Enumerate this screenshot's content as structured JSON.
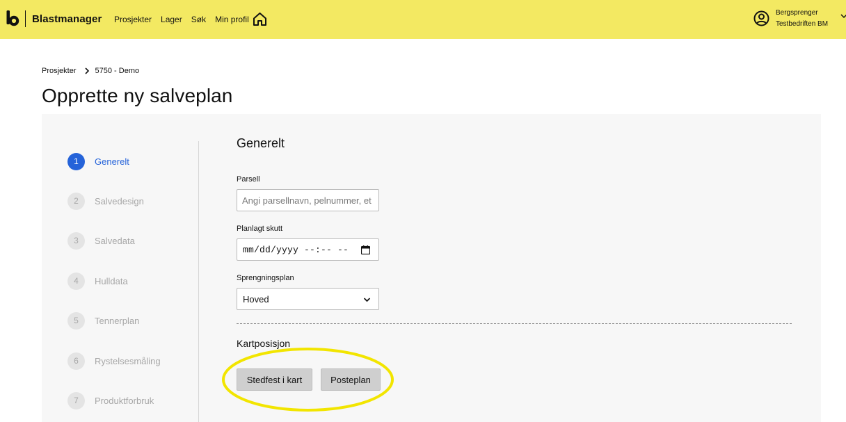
{
  "header": {
    "brand": "Blastmanager",
    "nav": [
      "Prosjekter",
      "Lager",
      "Søk",
      "Min profil"
    ],
    "icons": {
      "logo": "blastmanager-logo-icon",
      "home": "home-icon",
      "user": "user-circle-icon",
      "chevron": "chevron-down-icon"
    },
    "user": {
      "name": "Bergsprenger",
      "company": "Testbedriften BM"
    },
    "bg_color": "#f3e962"
  },
  "breadcrumb": [
    "Prosjekter",
    "5750 - Demo"
  ],
  "page_title": "Opprette ny salveplan",
  "steps": [
    {
      "num": "1",
      "label": "Generelt",
      "active": true
    },
    {
      "num": "2",
      "label": "Salvedesign",
      "active": false
    },
    {
      "num": "3",
      "label": "Salvedata",
      "active": false
    },
    {
      "num": "4",
      "label": "Hulldata",
      "active": false
    },
    {
      "num": "5",
      "label": "Tennerplan",
      "active": false
    },
    {
      "num": "6",
      "label": "Rystelsesmåling",
      "active": false
    },
    {
      "num": "7",
      "label": "Produktforbruk",
      "active": false
    }
  ],
  "form": {
    "section_title": "Generelt",
    "parsell": {
      "label": "Parsell",
      "placeholder": "Angi parsellnavn, pelnummer, et",
      "value": ""
    },
    "planlagt": {
      "label": "Planlagt skutt",
      "value": "mm/dd/yyyy --:-- --"
    },
    "sprengningsplan": {
      "label": "Sprengningsplan",
      "selected": "Hoved"
    },
    "kart": {
      "title": "Kartposisjon",
      "buttons": [
        "Stedfest i kart",
        "Posteplan"
      ]
    }
  },
  "colors": {
    "accent": "#2563d9",
    "highlight": "#f2e500",
    "panel": "#f7f7f7"
  }
}
